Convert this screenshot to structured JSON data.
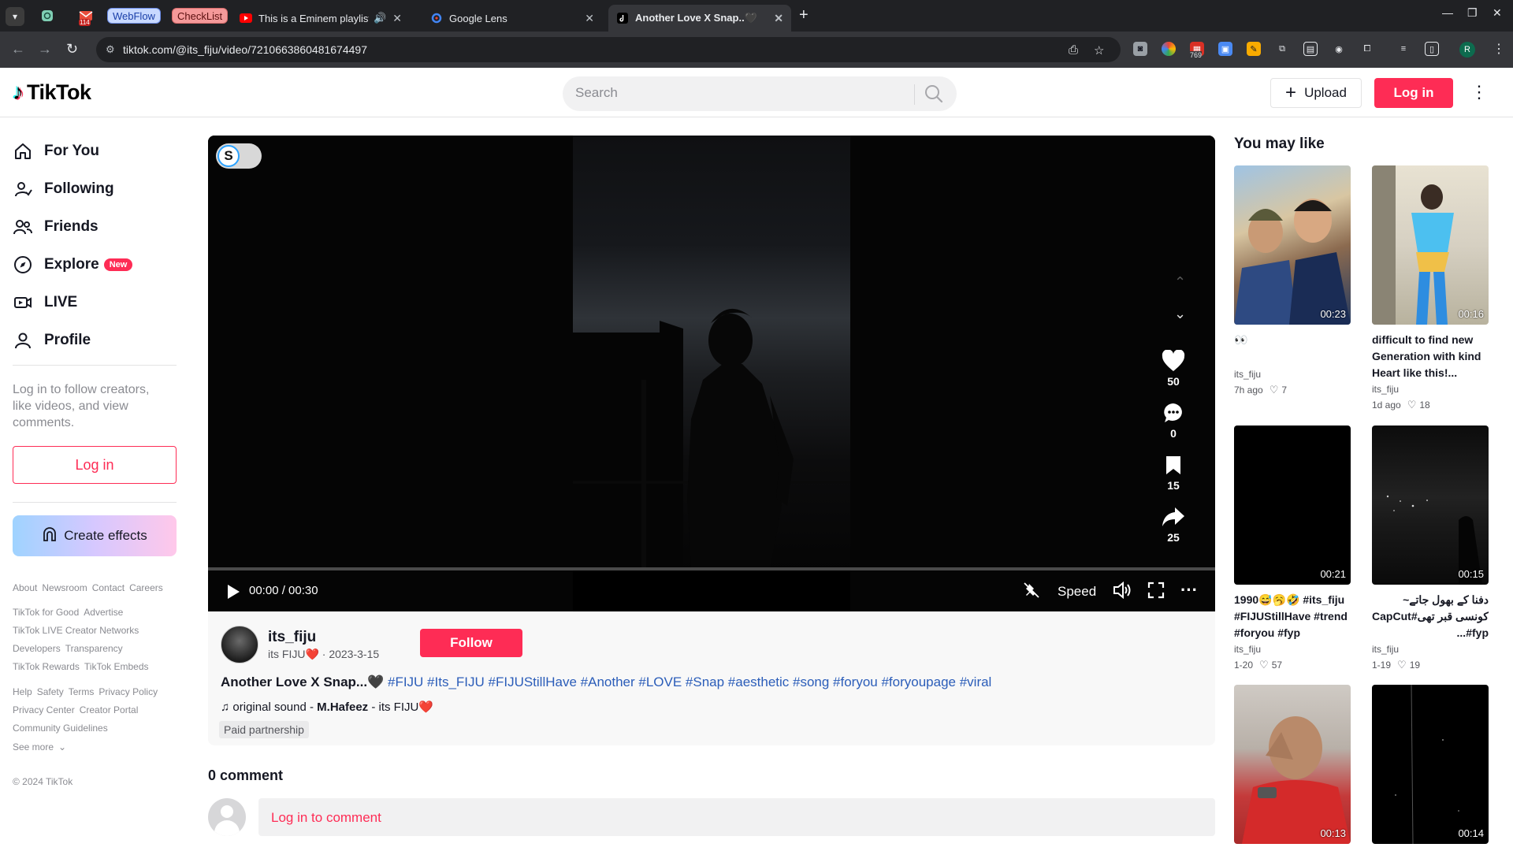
{
  "browser": {
    "tabs": [
      {
        "title": "WebFlow"
      },
      {
        "title": "CheckList"
      },
      {
        "title": "This is a Eminem playlist"
      },
      {
        "title": "Google Lens"
      },
      {
        "title": "Another Love X Snap..🖤"
      }
    ],
    "pinned_badge": "114",
    "url": "tiktok.com/@its_fiju/video/7210663860481674497",
    "extension_badge": "769",
    "profile_initial": "R"
  },
  "header": {
    "logo_text": "TikTok",
    "search_placeholder": "Search",
    "upload_label": "Upload",
    "login_label": "Log in"
  },
  "sidebar": {
    "nav": [
      {
        "label": "For You",
        "icon": "home-icon"
      },
      {
        "label": "Following",
        "icon": "following-icon"
      },
      {
        "label": "Friends",
        "icon": "friends-icon"
      },
      {
        "label": "Explore",
        "icon": "compass-icon",
        "badge": "New"
      },
      {
        "label": "LIVE",
        "icon": "live-icon"
      },
      {
        "label": "Profile",
        "icon": "profile-icon"
      }
    ],
    "login_prompt": "Log in to follow creators, like videos, and view comments.",
    "login_button": "Log in",
    "create_effects": "Create effects",
    "footer_rows": [
      [
        "About",
        "Newsroom",
        "Contact",
        "Careers"
      ],
      [
        "TikTok for Good",
        "Advertise"
      ],
      [
        "TikTok LIVE Creator Networks"
      ],
      [
        "Developers",
        "Transparency"
      ],
      [
        "TikTok Rewards",
        "TikTok Embeds"
      ],
      [
        "Help",
        "Safety",
        "Terms",
        "Privacy Policy"
      ],
      [
        "Privacy Center",
        "Creator Portal"
      ],
      [
        "Community Guidelines"
      ]
    ],
    "see_more": "See more",
    "copyright": "© 2024 TikTok"
  },
  "player": {
    "toggle_letter": "S",
    "likes": "50",
    "comments": "0",
    "saves": "15",
    "shares": "25",
    "time": "00:00 / 00:30",
    "speed_label": "Speed",
    "progress": 0
  },
  "video": {
    "author": "its_fiju",
    "author_display": "its FIJU❤️",
    "date": "2023-3-15",
    "follow_label": "Follow",
    "title": "Another Love X Snap...🖤",
    "hashtags": "#FIJU #Its_FIJU #FIJUStillHave #Another #LOVE #Snap #aesthetic #song #foryou #foryoupage #viral",
    "music_prefix": "original sound - ",
    "music_author": "M.Hafeez",
    "music_suffix": " - its FIJU❤️",
    "paid_label": "Paid partnership"
  },
  "comments": {
    "count_label": "0 comment",
    "login_prompt": "Log in to comment"
  },
  "you_may_like": {
    "title": "You may like",
    "cards": [
      {
        "duration": "00:23",
        "title": "👀",
        "author": "its_fiju",
        "age": "7h ago",
        "likes": "7"
      },
      {
        "duration": "00:16",
        "title": "difficult to find new Generation with kind Heart like this!...",
        "author": "its_fiju",
        "age": "1d ago",
        "likes": "18"
      },
      {
        "duration": "00:21",
        "title": "1990😅🥱🤣 #its_fiju #FIJUStillHave #trend #foryou #fyp",
        "author": "its_fiju",
        "age": "1-20",
        "likes": "57"
      },
      {
        "duration": "00:15",
        "title": "دفنا کے بھول جاتے~ کونسی قبر تھی#CapCut #fyp...",
        "author": "its_fiju",
        "age": "1-19",
        "likes": "19"
      },
      {
        "duration": "00:13",
        "title": "",
        "author": "",
        "age": "",
        "likes": ""
      },
      {
        "duration": "00:14",
        "title": "",
        "author": "",
        "age": "",
        "likes": ""
      }
    ]
  },
  "colors": {
    "brand_red": "#fe2c55",
    "hashtag_blue": "#2b5db9",
    "browser_dark": "#202124"
  }
}
